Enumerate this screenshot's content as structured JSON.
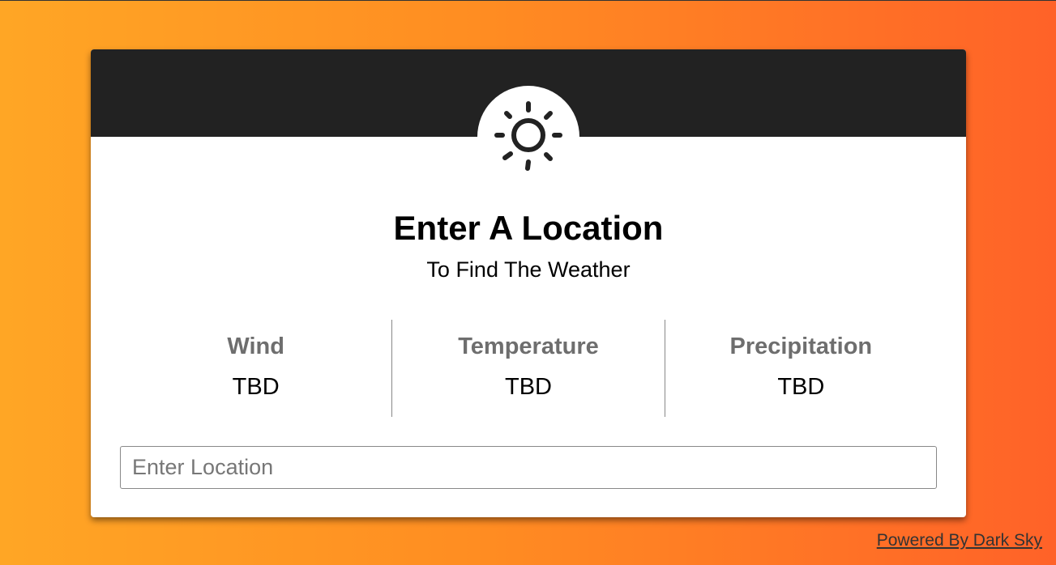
{
  "header": {
    "icon": "sun-icon"
  },
  "main": {
    "title": "Enter A Location",
    "subtitle": "To Find The Weather"
  },
  "stats": [
    {
      "label": "Wind",
      "value": "TBD"
    },
    {
      "label": "Temperature",
      "value": "TBD"
    },
    {
      "label": "Precipitation",
      "value": "TBD"
    }
  ],
  "search": {
    "placeholder": "Enter Location",
    "value": ""
  },
  "footer": {
    "powered_by": "Powered By Dark Sky"
  },
  "colors": {
    "gradient_start": "#ffa625",
    "gradient_end": "#ff6228",
    "header_bg": "#222222",
    "label_gray": "#6e6e6e"
  }
}
